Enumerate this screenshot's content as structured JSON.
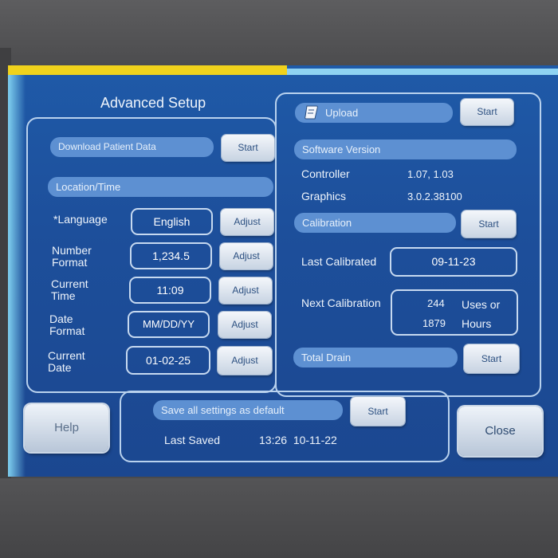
{
  "header": {
    "title": "Advanced Setup"
  },
  "download": {
    "label": "Download Patient Data",
    "button": "Start"
  },
  "location": {
    "header": "Location/Time",
    "rows": [
      {
        "label": "*Language",
        "value": "English",
        "button": "Adjust"
      },
      {
        "label": "Number\nFormat",
        "value": "1,234.5",
        "button": "Adjust"
      },
      {
        "label": "Current\nTime",
        "value": "11:09",
        "button": "Adjust"
      },
      {
        "label": "Date\nFormat",
        "value": "MM/DD/YY",
        "button": "Adjust"
      },
      {
        "label": "Current\nDate",
        "value": "01-02-25",
        "button": "Adjust"
      }
    ]
  },
  "upload": {
    "label": "Upload",
    "button": "Start",
    "icon": "scroll-icon"
  },
  "software": {
    "header": "Software Version",
    "controller_label": "Controller",
    "controller_value": "1.07, 1.03",
    "graphics_label": "Graphics",
    "graphics_value": "3.0.2.38100"
  },
  "calibration": {
    "header": "Calibration",
    "button": "Start",
    "last_label": "Last Calibrated",
    "last_value": "09-11-23",
    "next_label": "Next Calibration",
    "uses_value": "244",
    "uses_label": "Uses or",
    "hours_value": "1879",
    "hours_label": "Hours"
  },
  "drain": {
    "label": "Total Drain",
    "button": "Start"
  },
  "save": {
    "label": "Save all settings as default",
    "button": "Start",
    "last_saved_label": "Last Saved",
    "last_saved_value": "13:26  10-11-22"
  },
  "footer": {
    "help": "Help",
    "close": "Close"
  }
}
